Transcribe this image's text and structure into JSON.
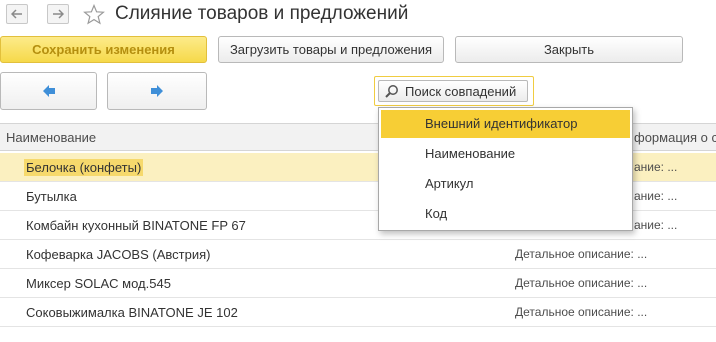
{
  "window": {
    "title": "Слияние товаров и предложений",
    "nav": {
      "back_icon": "arrow-left-icon",
      "forward_icon": "arrow-right-icon",
      "favorite_icon": "star-icon"
    }
  },
  "toolbar": {
    "save_label": "Сохранить изменения",
    "load_label": "Загрузить товары и предложения",
    "close_label": "Закрыть"
  },
  "search": {
    "label": "Поиск совпадений",
    "icon": "magnifier-icon",
    "options": [
      {
        "label": "Внешний идентификатор",
        "active": true
      },
      {
        "label": "Наименование",
        "active": false
      },
      {
        "label": "Артикул",
        "active": false
      },
      {
        "label": "Код",
        "active": false
      }
    ]
  },
  "table": {
    "columns": [
      "Наименование",
      "формация о су"
    ],
    "rows": [
      {
        "name": "Белочка (конфеты)",
        "desc": "ание: ...",
        "selected": true
      },
      {
        "name": "Бутылка",
        "desc": "ание: ...",
        "selected": false
      },
      {
        "name": "Комбайн кухонный BINATONE FP 67",
        "desc": "ание: ...",
        "selected": false
      },
      {
        "name": "Кофеварка JACOBS (Австрия)",
        "desc": "Детальное описание: ...",
        "selected": false
      },
      {
        "name": "Миксер SOLAC мод.545",
        "desc": "Детальное описание: ...",
        "selected": false
      },
      {
        "name": "Соковыжималка  BINATONE JE 102",
        "desc": "Детальное описание: ...",
        "selected": false
      }
    ]
  },
  "colors": {
    "accent": "#f7ce35",
    "selected_row": "#fbf0c0",
    "primary_button_text": "#b58f0f",
    "arrow_blue": "#3f8fd8"
  }
}
